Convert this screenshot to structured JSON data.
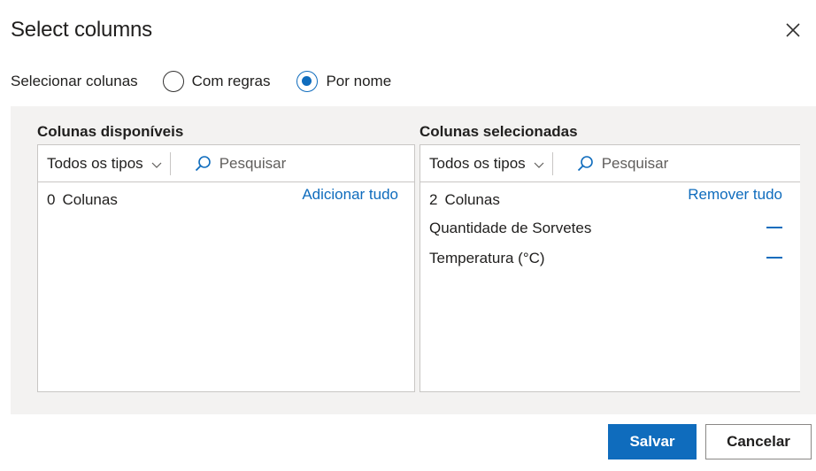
{
  "dialog": {
    "title": "Select columns",
    "close_icon": "close-icon"
  },
  "mode": {
    "label": "Selecionar colunas",
    "options": [
      {
        "label": "Com regras",
        "checked": false
      },
      {
        "label": "Por nome",
        "checked": true
      }
    ]
  },
  "available": {
    "title": "Colunas disponíveis",
    "type_filter": "Todos os tipos",
    "search_placeholder": "Pesquisar",
    "count": "0",
    "count_label": "Colunas",
    "action": "Adicionar tudo",
    "items": []
  },
  "selected": {
    "title": "Colunas selecionadas",
    "type_filter": "Todos os tipos",
    "search_placeholder": "Pesquisar",
    "count": "2",
    "count_label": "Colunas",
    "action": "Remover tudo",
    "items": [
      {
        "label": "Quantidade de Sorvetes"
      },
      {
        "label": "Temperatura (°C)"
      }
    ]
  },
  "footer": {
    "save": "Salvar",
    "cancel": "Cancelar"
  },
  "colors": {
    "accent": "#0f6cbd",
    "panel_bg": "#f3f2f1"
  }
}
